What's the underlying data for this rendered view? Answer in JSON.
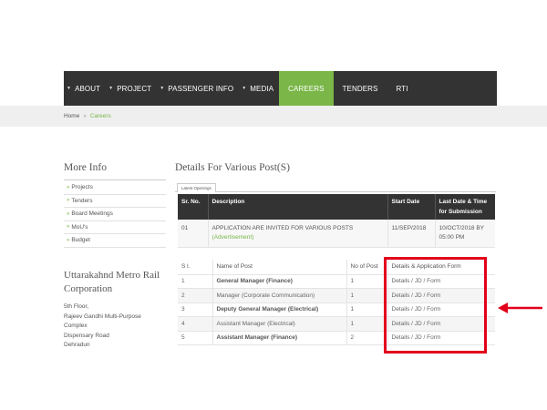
{
  "nav": {
    "items": [
      {
        "label": "ABOUT",
        "dropdown": true,
        "active": false
      },
      {
        "label": "PROJECT",
        "dropdown": true,
        "active": false
      },
      {
        "label": "PASSENGER INFO",
        "dropdown": true,
        "active": false
      },
      {
        "label": "MEDIA",
        "dropdown": true,
        "active": false
      },
      {
        "label": "CAREERS",
        "dropdown": false,
        "active": true
      },
      {
        "label": "TENDERS",
        "dropdown": false,
        "active": false
      },
      {
        "label": "RTI",
        "dropdown": false,
        "active": false
      }
    ]
  },
  "breadcrumb": {
    "home": "Home",
    "separator": "»",
    "current": "Careers"
  },
  "sidebar": {
    "title": "More Info",
    "bullet": "»",
    "items": [
      "Projects",
      "Tenders",
      "Board Meetings",
      "MoU's",
      "Budget"
    ],
    "org_title": "Uttarakahnd Metro Rail Corporation",
    "address": [
      "5th Floor,",
      "Rajeev Gandhi Multi-Purpose",
      "Complex",
      "Dispensary Road",
      "Dehradun"
    ]
  },
  "main": {
    "title": "Details For Various Post(S)",
    "tab_label": "Latest Openings",
    "notice_table": {
      "headers": [
        "Sr. No.",
        "Description",
        "Start Date",
        "Last Date & Time for Submission"
      ],
      "rows": [
        {
          "sr": "01",
          "description": "APPLICATION ARE INVITED FOR VARIOUS POSTS",
          "link": "(Advertisement)",
          "start_date": "11/SEP/2018",
          "last_date": "10/OCT/2018 BY 05:00 PM"
        }
      ]
    },
    "posts_table": {
      "headers": [
        "S l.",
        "Name of Post",
        "No of Post",
        "Details & Application Form"
      ],
      "rows": [
        {
          "sl": "1",
          "name": "General Manager (Finance)",
          "count": "1",
          "link": "Details / JD / Form",
          "bold": true
        },
        {
          "sl": "2",
          "name": "Manager (Corporate Communication)",
          "count": "1",
          "link": "Details / JD / Form",
          "bold": false
        },
        {
          "sl": "3",
          "name": "Deputy General Manager (Electrical)",
          "count": "1",
          "link": "Details / JD / Form",
          "bold": true
        },
        {
          "sl": "4",
          "name": "Assistant Manager (Electrical)",
          "count": "1",
          "link": "Details / JD / Form",
          "bold": false
        },
        {
          "sl": "5",
          "name": "Assistant Manager (Finance)",
          "count": "2",
          "link": "Details / JD / Form",
          "bold": true
        }
      ]
    }
  },
  "colors": {
    "nav_bg": "#333333",
    "accent_green": "#7ab648",
    "annotation_red": "#e3001b"
  }
}
